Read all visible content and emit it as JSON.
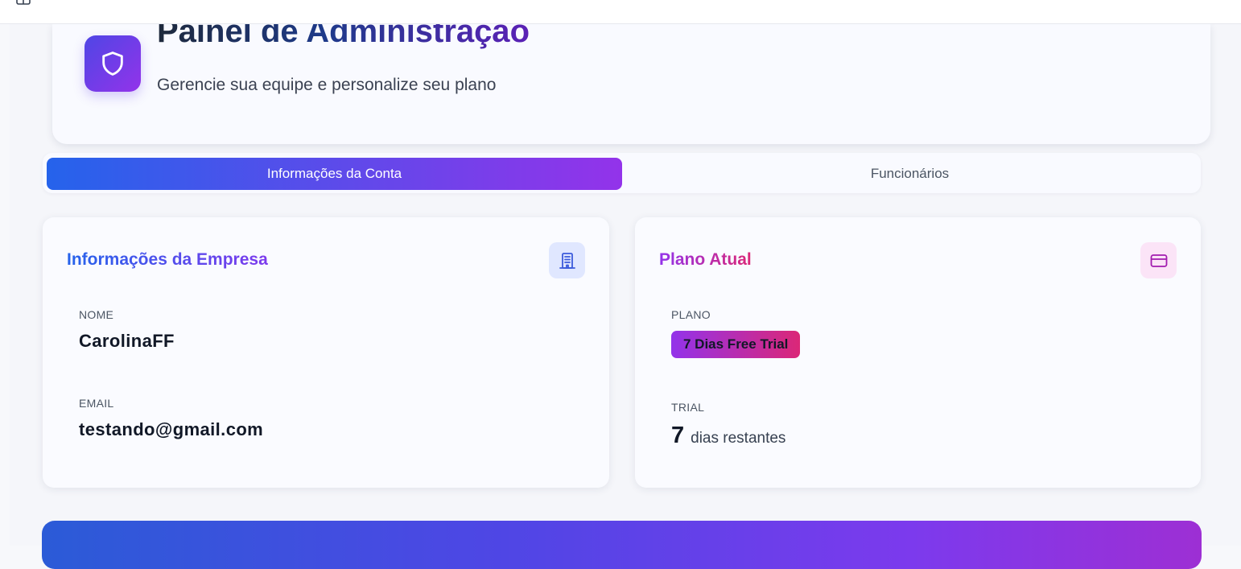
{
  "header": {
    "title": "Painel de Administração",
    "subtitle": "Gerencie sua equipe e personalize seu plano",
    "icon": "shield-icon"
  },
  "tabs": [
    {
      "label": "Informações da Conta",
      "active": true
    },
    {
      "label": "Funcionários",
      "active": false
    }
  ],
  "company_card": {
    "title": "Informações da Empresa",
    "icon": "building-icon",
    "name_label": "NOME",
    "name_value": "CarolinaFF",
    "email_label": "EMAIL",
    "email_value": "testando@gmail.com"
  },
  "plan_card": {
    "title": "Plano Atual",
    "icon": "credit-card-icon",
    "plan_label": "PLANO",
    "plan_value": "7 Dias Free Trial",
    "trial_label": "TRIAL",
    "trial_days": "7",
    "trial_suffix": "dias restantes"
  },
  "colors": {
    "accent_blue": "#2563eb",
    "accent_purple": "#9333ea",
    "accent_pink": "#db2777"
  }
}
